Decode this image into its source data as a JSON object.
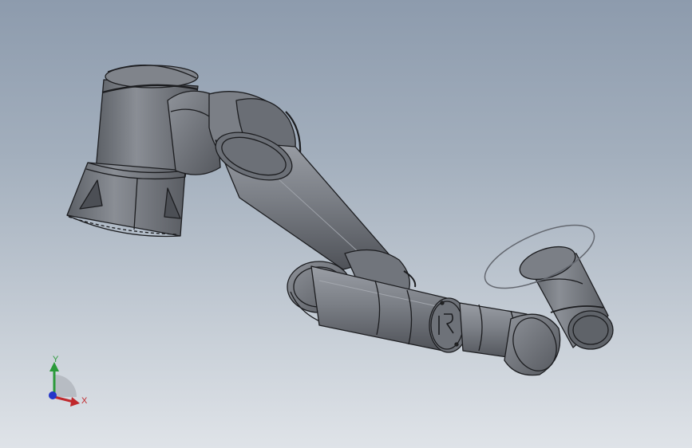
{
  "triad": {
    "x_label": "X",
    "y_label": "Y",
    "x_color": "#c0282c",
    "y_color": "#2b9a3a",
    "z_color": "#2436c8"
  },
  "model": {
    "body_color": "#6f737a",
    "edge_color": "#1c1d20",
    "logo_icon": "robot-brand-logo-icon"
  }
}
